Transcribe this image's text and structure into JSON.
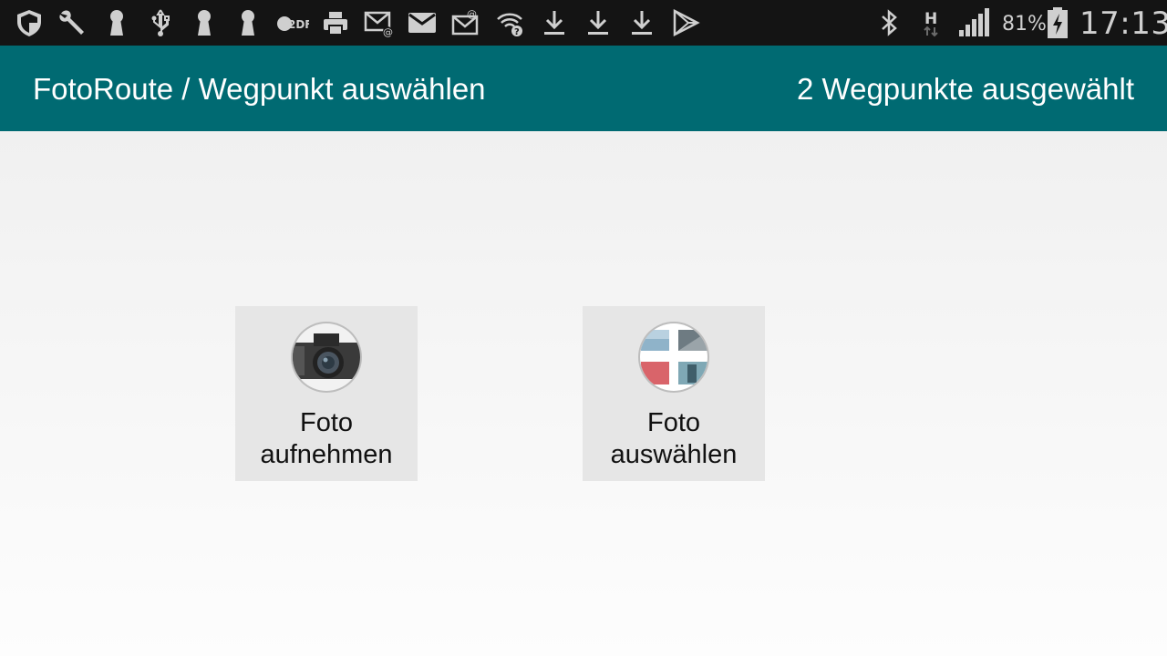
{
  "status_bar": {
    "icons": [
      "shield-icon",
      "wrench-icon",
      "keyhole-icon",
      "usb-icon",
      "keyhole-icon",
      "keyhole-icon",
      "zdf-icon",
      "printer-icon",
      "email-at-icon",
      "mail-icon",
      "email-at-icon",
      "wifi-question-icon",
      "download-icon",
      "download-icon",
      "download-icon",
      "play-store-icon",
      "bluetooth-icon",
      "h-data-icon",
      "signal-icon",
      "battery-charging-icon"
    ],
    "battery_percent": "81%",
    "time": "17:13"
  },
  "action_bar": {
    "title": "FotoRoute / Wegpunkt auswählen",
    "status": "2 Wegpunkte ausgewählt",
    "color": "#006a72"
  },
  "buttons": [
    {
      "line1": "Foto",
      "line2": "aufnehmen",
      "icon": "camera-icon"
    },
    {
      "line1": "Foto",
      "line2": "auswählen",
      "icon": "photo-gallery-icon"
    }
  ]
}
